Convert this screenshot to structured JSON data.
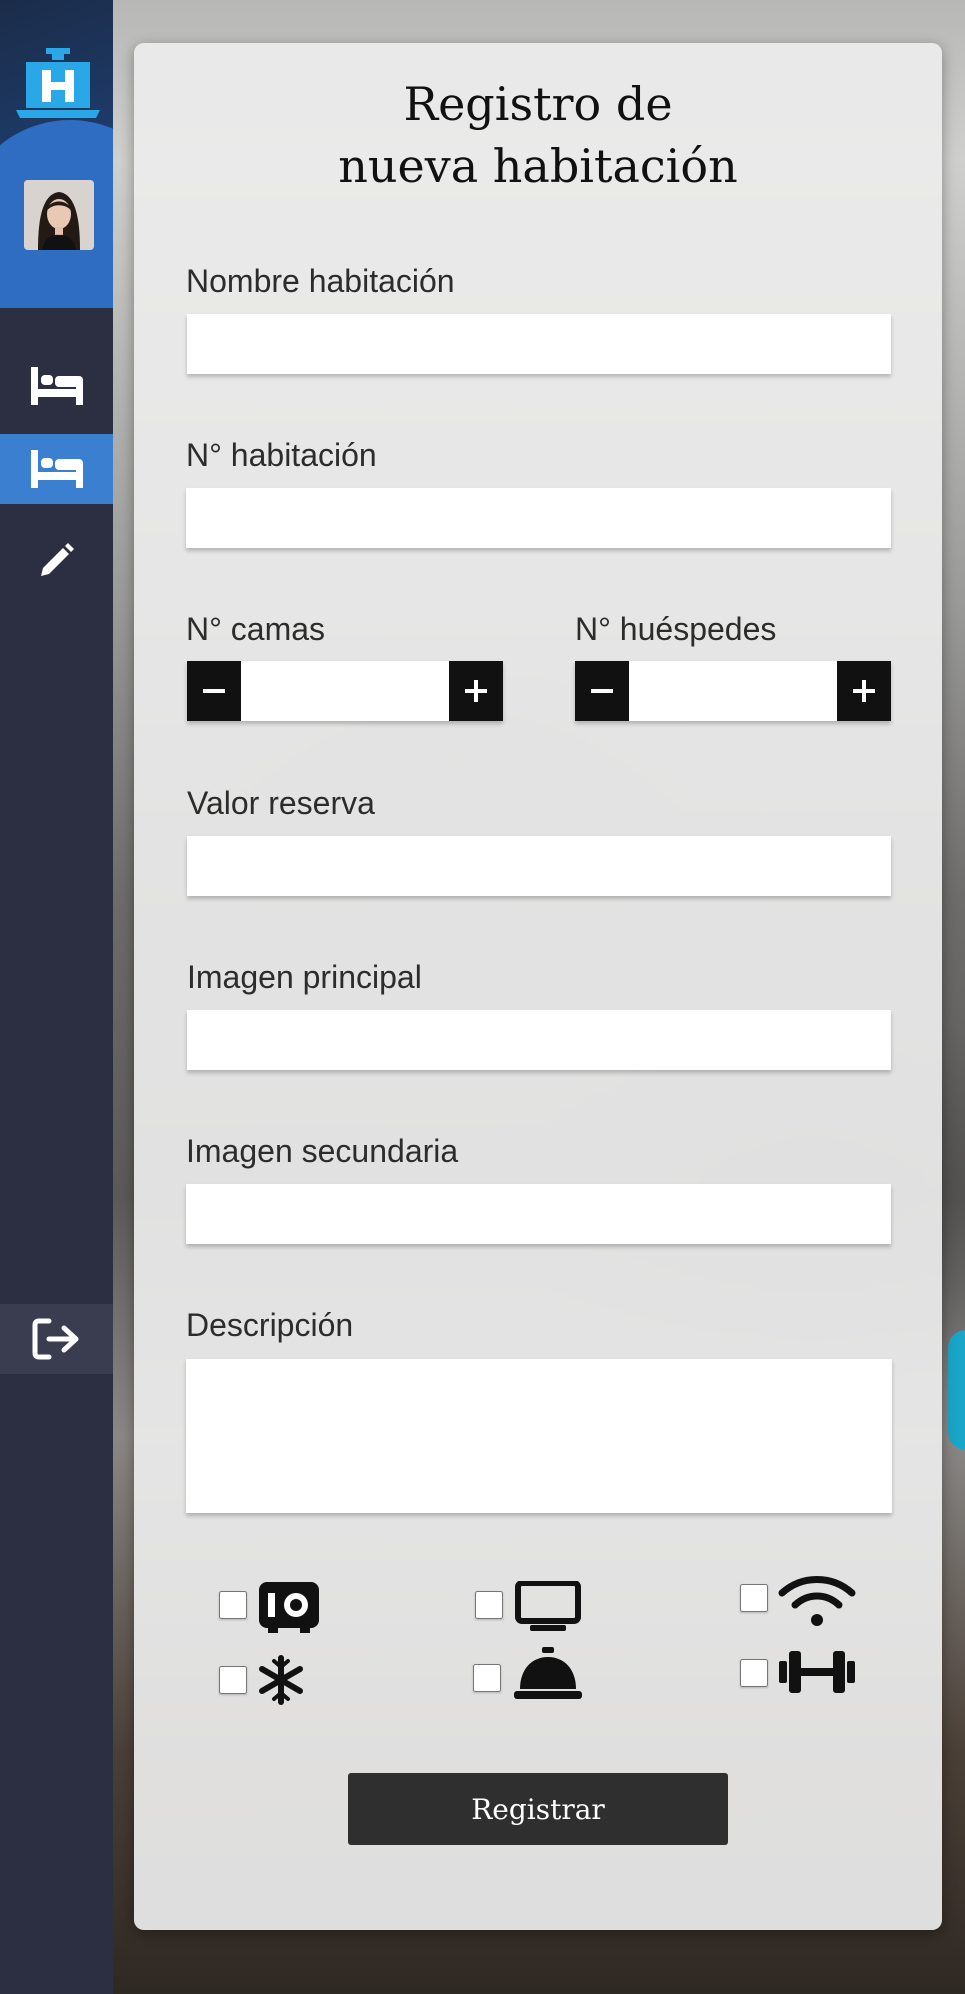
{
  "form": {
    "title_line1": "Registro de",
    "title_line2": "nueva habitación",
    "labels": {
      "name": "Nombre habitación",
      "room_number": "N° habitación",
      "beds": "N° camas",
      "guests": "N° huéspedes",
      "price": "Valor reserva",
      "main_image": "Imagen principal",
      "secondary_image": "Imagen secundaria",
      "description": "Descripción"
    },
    "values": {
      "name": "",
      "room_number": "",
      "beds": "",
      "guests": "",
      "price": "",
      "main_image": "",
      "secondary_image": "",
      "description": ""
    },
    "amenities": [
      {
        "icon": "safe-icon",
        "checked": false
      },
      {
        "icon": "tv-icon",
        "checked": false
      },
      {
        "icon": "wifi-icon",
        "checked": false
      },
      {
        "icon": "snowflake-icon",
        "checked": false
      },
      {
        "icon": "service-bell-icon",
        "checked": false
      },
      {
        "icon": "dumbbell-icon",
        "checked": false
      }
    ],
    "submit_label": "Registrar"
  },
  "sidebar": {
    "items": [
      {
        "icon": "bed-icon",
        "active": false
      },
      {
        "icon": "bed-icon",
        "active": true
      },
      {
        "icon": "pencil-icon",
        "active": false
      },
      {
        "icon": "logout-icon",
        "active": false
      }
    ]
  },
  "colors": {
    "sidebar": "#2c2f42",
    "accent": "#3a7fd0",
    "logo": "#2aa7e6",
    "button": "#2f2f2f"
  }
}
